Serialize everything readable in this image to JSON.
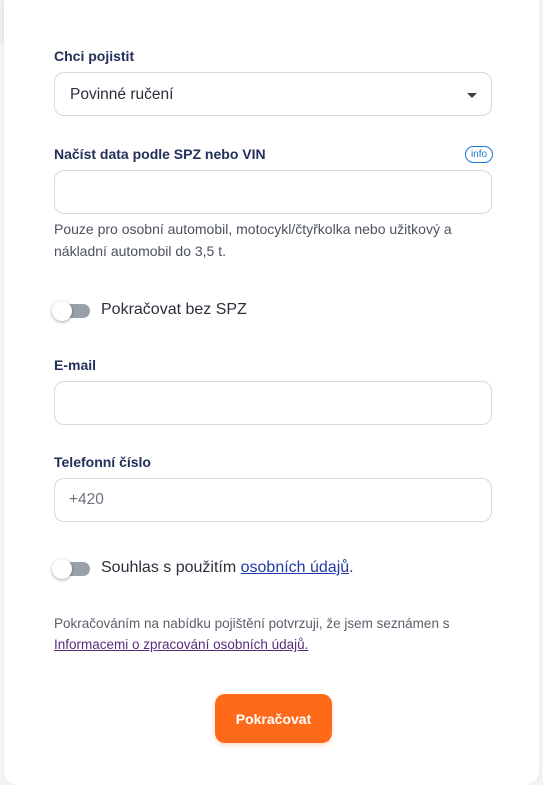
{
  "form": {
    "insure_label": "Chci pojistit",
    "insure_value": "Povinné ručení",
    "spz_label": "Načíst data podle SPZ nebo VIN",
    "info_badge": "info",
    "spz_value": "",
    "spz_helper": "Pouze pro osobní automobil, motocykl/čtyřkolka nebo užitkový a nákladní automobil do 3,5 t.",
    "no_spz_toggle_label": "Pokračovat bez SPZ",
    "email_label": "E-mail",
    "email_value": "",
    "phone_label": "Telefonní číslo",
    "phone_placeholder": "+420",
    "consent_prefix": "Souhlas s použitím ",
    "consent_link": "osobních údajů",
    "consent_suffix": ".",
    "legal_text": "Pokračováním na nabídku pojištění potvrzuji, že jsem seznámen s ",
    "legal_link": "Informacemi o zpracování osobních údajů.",
    "submit_label": "Pokračovat"
  },
  "colors": {
    "accent": "#ff6a1a",
    "label": "#22305a",
    "link": "#1f3aa8",
    "info": "#1976d2"
  }
}
